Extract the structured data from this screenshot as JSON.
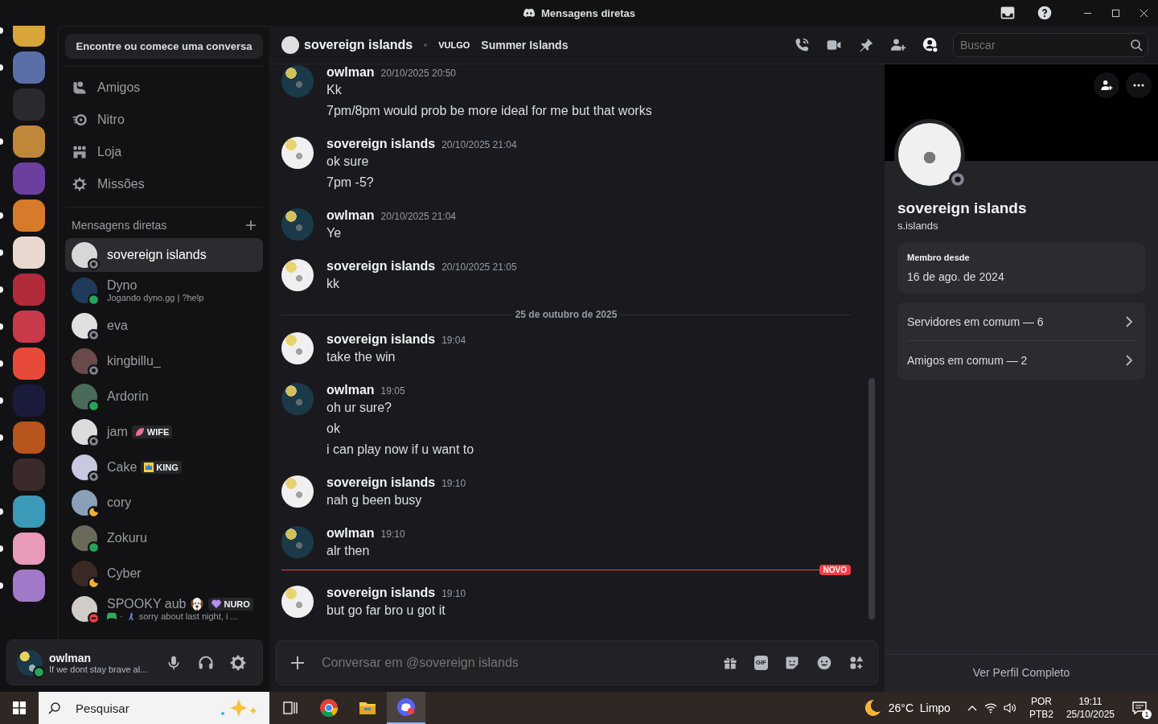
{
  "window": {
    "title": "Mensagens diretas"
  },
  "servers": [
    {
      "unread": true
    },
    {
      "unread": true
    },
    {
      "unread": false
    },
    {
      "unread": true
    },
    {
      "unread": false
    },
    {
      "unread": true
    },
    {
      "unread": true
    },
    {
      "unread": true
    },
    {
      "unread": true
    },
    {
      "unread": true
    },
    {
      "unread": true
    },
    {
      "unread": true
    },
    {
      "unread": false
    },
    {
      "unread": true
    },
    {
      "unread": true
    },
    {
      "unread": true
    }
  ],
  "sidebar": {
    "search_button": "Encontre ou comece uma conversa",
    "nav": [
      {
        "kind": "friends",
        "label": "Amigos"
      },
      {
        "kind": "nitro",
        "label": "Nitro"
      },
      {
        "kind": "shop",
        "label": "Loja"
      },
      {
        "kind": "quests",
        "label": "Missões"
      }
    ],
    "dm_header": "Mensagens diretas",
    "dms": [
      {
        "name": "sovereign islands",
        "color": "#80848e",
        "selected": true
      },
      {
        "name": "Dyno",
        "subtitle": "Jogando dyno.gg | ?help",
        "color": "#23a55a",
        "selected": false
      },
      {
        "name": "eva",
        "color": "#80848e",
        "selected": false
      },
      {
        "name": "kingbillu_",
        "color": "#80848e",
        "selected": false
      },
      {
        "name": "Ardorin",
        "color": "#23a55a",
        "selected": false
      },
      {
        "name": "jam",
        "color": "#80848e",
        "selected": false,
        "tag": {
          "kind": "leaf",
          "label": "WIFE"
        }
      },
      {
        "name": "Cake",
        "color": "#80848e",
        "selected": false,
        "tag": {
          "kind": "crown",
          "label": "KING"
        }
      },
      {
        "name": "cory",
        "color": "#f0b232",
        "selected": false
      },
      {
        "name": "Zokuru",
        "color": "#23a55a",
        "selected": false
      },
      {
        "name": "Cyber",
        "color": "#f0b232",
        "selected": false
      },
      {
        "name": "SPOOKY aub",
        "name_emoji": true,
        "color": "#f23f43",
        "selected": false,
        "tag": {
          "kind": "heart",
          "label": "NURO"
        },
        "activity": {
          "separator": "·"
        },
        "subtitle": "sorry about last night, i ..."
      }
    ]
  },
  "user_panel": {
    "name": "owlman",
    "status_text": "If we dont stay brave al...",
    "color": "#23a55a"
  },
  "header": {
    "name": "sovereign islands",
    "tag": "VULGO",
    "tag_name": "Summer Islands",
    "search_placeholder": "Buscar"
  },
  "messages": [
    {
      "kind": "group",
      "author": "owlman",
      "color": "#1a3a4a",
      "time": "20/10/2025 20:50",
      "lines": [
        "Kk",
        "7pm/8pm would prob be more ideal for me but that works"
      ]
    },
    {
      "kind": "group",
      "author": "sovereign islands",
      "color": "#f0f0f0",
      "time": "20/10/2025 21:04",
      "lines": [
        "ok sure",
        "7pm -5?"
      ]
    },
    {
      "kind": "group",
      "author": "owlman",
      "color": "#1a3a4a",
      "time": "20/10/2025 21:04",
      "lines": [
        "Ye"
      ]
    },
    {
      "kind": "group",
      "author": "sovereign islands",
      "color": "#f0f0f0",
      "time": "20/10/2025 21:05",
      "lines": [
        "kk"
      ]
    },
    {
      "kind": "date_divider",
      "label": "25 de outubro de 2025"
    },
    {
      "kind": "group",
      "author": "sovereign islands",
      "color": "#f0f0f0",
      "time": "19:04",
      "lines": [
        "take the win"
      ]
    },
    {
      "kind": "group",
      "author": "owlman",
      "color": "#1a3a4a",
      "time": "19:05",
      "lines": [
        "oh ur sure?",
        "ok",
        "i can play now if u want to"
      ]
    },
    {
      "kind": "group",
      "author": "sovereign islands",
      "color": "#f0f0f0",
      "time": "19:10",
      "lines": [
        "nah g been busy"
      ]
    },
    {
      "kind": "group",
      "author": "owlman",
      "color": "#1a3a4a",
      "time": "19:10",
      "lines": [
        "alr then"
      ]
    },
    {
      "kind": "new_divider",
      "label": "NOVO"
    },
    {
      "kind": "group",
      "author": "sovereign islands",
      "color": "#f0f0f0",
      "time": "19:10",
      "lines": [
        "but go far bro u got it"
      ]
    }
  ],
  "composer": {
    "placeholder": "Conversar em @sovereign islands",
    "gif_label": "GIF"
  },
  "profile": {
    "name": "sovereign islands",
    "username": "s.islands",
    "color": "#80848e",
    "member_label": "Membro desde",
    "member_value": "16 de ago. de 2024",
    "rows": [
      "Servidores em comum — 6",
      "Amigos em comum — 2"
    ],
    "footer": "Ver Perfil Completo"
  },
  "taskbar": {
    "search": "Pesquisar",
    "apps": [
      {
        "kind": "chrome",
        "selected": false
      },
      {
        "kind": "explorer",
        "selected": false
      },
      {
        "kind": "discord",
        "selected": true
      }
    ],
    "weather": "26°C  Limpo",
    "lang": "POR",
    "layout": "PTB2",
    "time": "19:11",
    "date": "25/10/2025",
    "notifications": "1"
  }
}
